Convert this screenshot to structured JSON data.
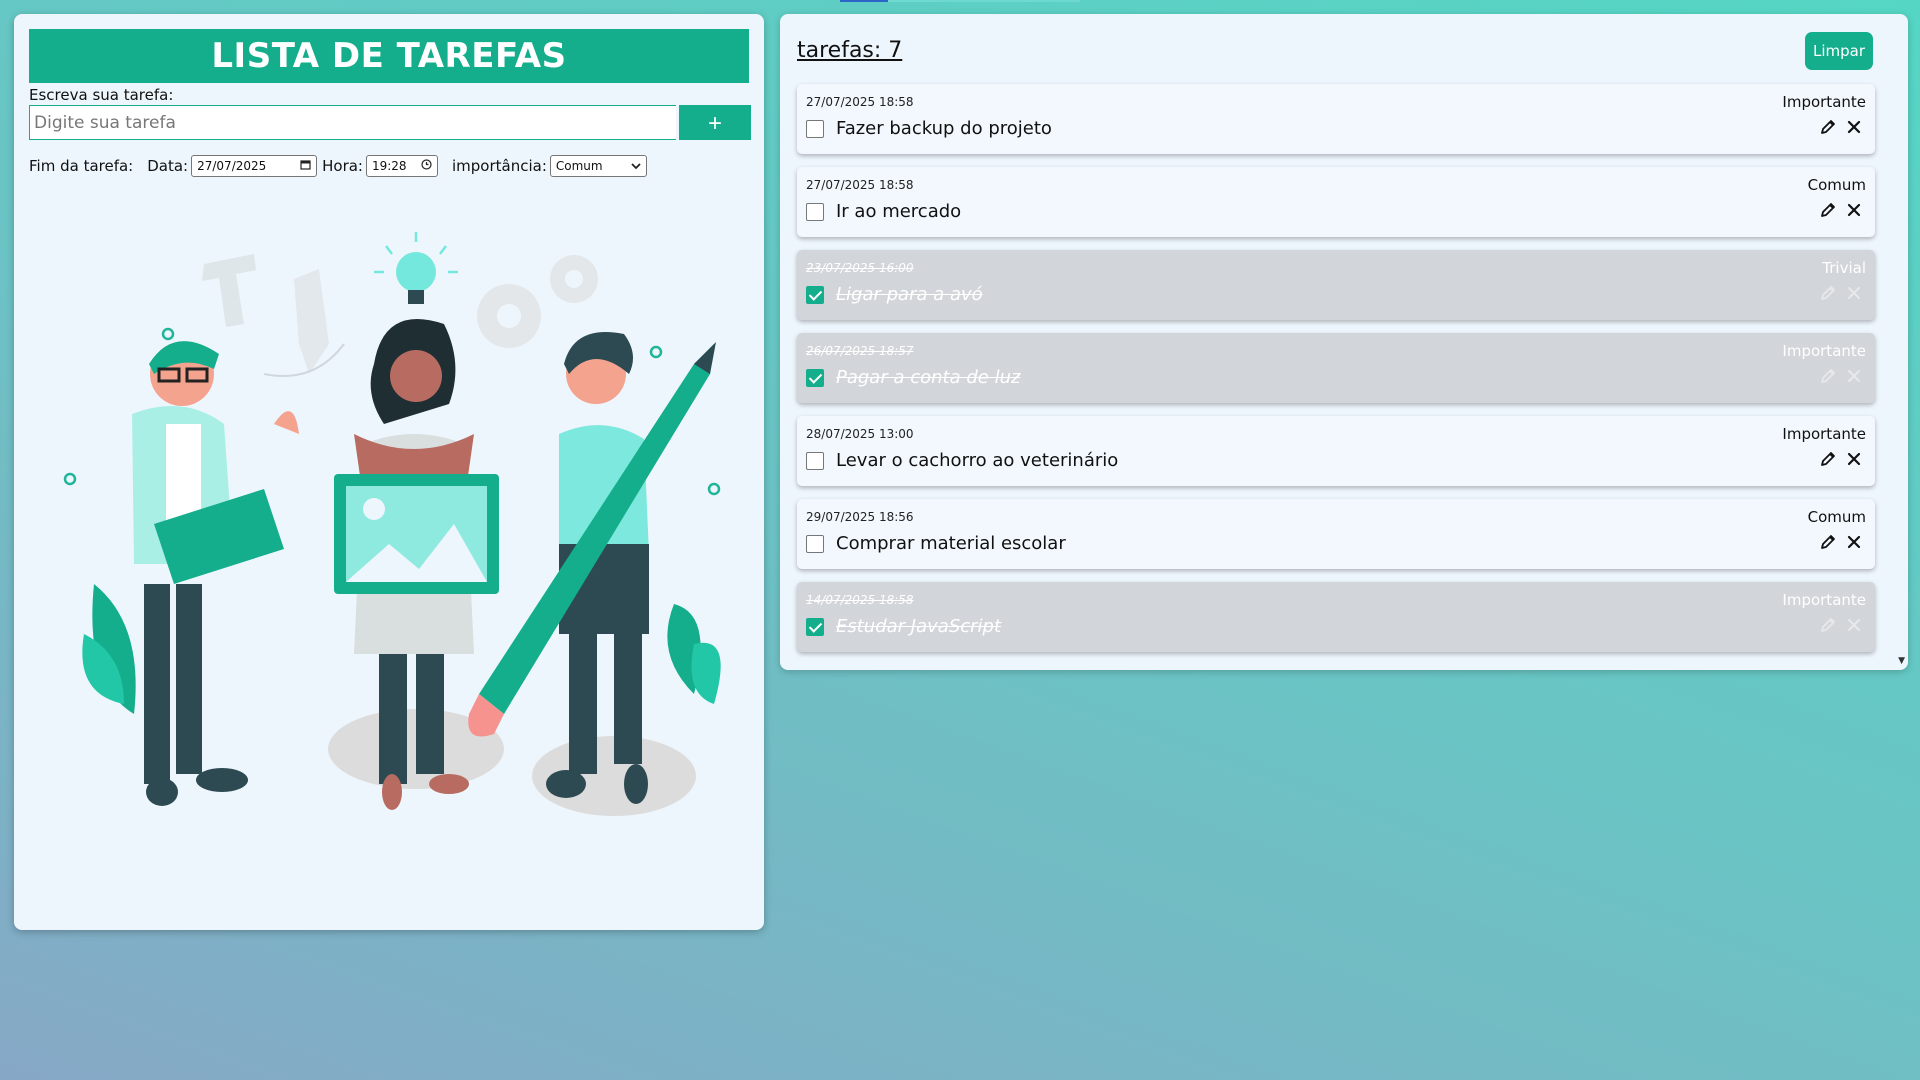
{
  "app": {
    "title": "LISTA DE TAREFAS"
  },
  "form": {
    "input_label": "Escreva sua tarefa:",
    "input_placeholder": "Digite sua tarefa",
    "add_label": "+",
    "fim_label": "Fim da tarefa:",
    "data_label": "Data:",
    "data_value": "27/07/2025",
    "hora_label": "Hora:",
    "hora_value": "19:28",
    "importancia_label": "importância:",
    "importancia_value": "Comum"
  },
  "list": {
    "count_label": "tarefas: 7",
    "clear_label": "Limpar",
    "tasks": [
      {
        "date": "27/07/2025 18:58",
        "priority": "Importante",
        "text": "Fazer backup do projeto",
        "done": false
      },
      {
        "date": "27/07/2025 18:58",
        "priority": "Comum",
        "text": "Ir ao mercado",
        "done": false
      },
      {
        "date": "23/07/2025 16:00",
        "priority": "Trivial",
        "text": "Ligar para a avó",
        "done": true
      },
      {
        "date": "26/07/2025 18:57",
        "priority": "Importante",
        "text": "Pagar a conta de luz",
        "done": true
      },
      {
        "date": "28/07/2025 13:00",
        "priority": "Importante",
        "text": "Levar o cachorro ao veterinário",
        "done": false
      },
      {
        "date": "29/07/2025 18:56",
        "priority": "Comum",
        "text": "Comprar material escolar",
        "done": false
      },
      {
        "date": "14/07/2025 18:58",
        "priority": "Importante",
        "text": "Estudar JavaScript",
        "done": true
      }
    ]
  },
  "colors": {
    "accent": "#14ae8c",
    "panel": "#eef6fd",
    "done_card": "#d2d5d9"
  },
  "icons": {
    "edit": "pencil-icon",
    "delete": "close-icon",
    "calendar": "calendar-icon",
    "clock": "clock-icon"
  }
}
